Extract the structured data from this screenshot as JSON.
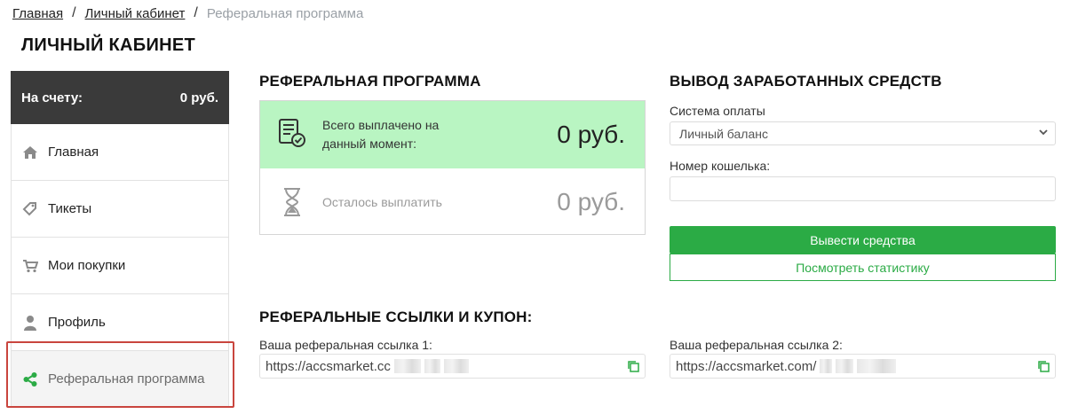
{
  "breadcrumb": {
    "home": "Главная",
    "cabinet": "Личный кабинет",
    "separator": "/",
    "current": "Реферальная программа"
  },
  "page_title": "ЛИЧНЫЙ КАБИНЕТ",
  "sidebar": {
    "balance_label": "На счету:",
    "balance_value": "0 руб.",
    "items": [
      {
        "label": "Главная",
        "icon": "home-icon"
      },
      {
        "label": "Тикеты",
        "icon": "ticket-icon"
      },
      {
        "label": "Мои покупки",
        "icon": "cart-icon"
      },
      {
        "label": "Профиль",
        "icon": "user-icon"
      },
      {
        "label": "Реферальная программа",
        "icon": "share-icon",
        "active": true
      }
    ]
  },
  "referral": {
    "title": "РЕФЕРАЛЬНАЯ ПРОГРАММА",
    "paid_label": "Всего выплачено на данный момент:",
    "paid_value": "0 руб.",
    "remaining_label": "Осталось выплатить",
    "remaining_value": "0 руб."
  },
  "withdraw": {
    "title": "ВЫВОД ЗАРАБОТАННЫХ СРЕДСТВ",
    "payment_system_label": "Система оплаты",
    "payment_system_value": "Личный баланс",
    "wallet_label": "Номер кошелька:",
    "wallet_value": "",
    "withdraw_button": "Вывести средства",
    "stats_button": "Посмотреть статистику"
  },
  "links": {
    "title": "РЕФЕРАЛЬНЫЕ ССЫЛКИ И КУПОН:",
    "link1_label": "Ваша реферальная ссылка 1:",
    "link1_value": "https://accsmarket.cc",
    "link2_label": "Ваша реферальная ссылка 2:",
    "link2_value": "https://accsmarket.com/"
  },
  "colors": {
    "accent": "#2bab45",
    "paid_bg": "#b9f5c2",
    "balance_bg": "#3a3a3a",
    "highlight": "#c9453e"
  }
}
